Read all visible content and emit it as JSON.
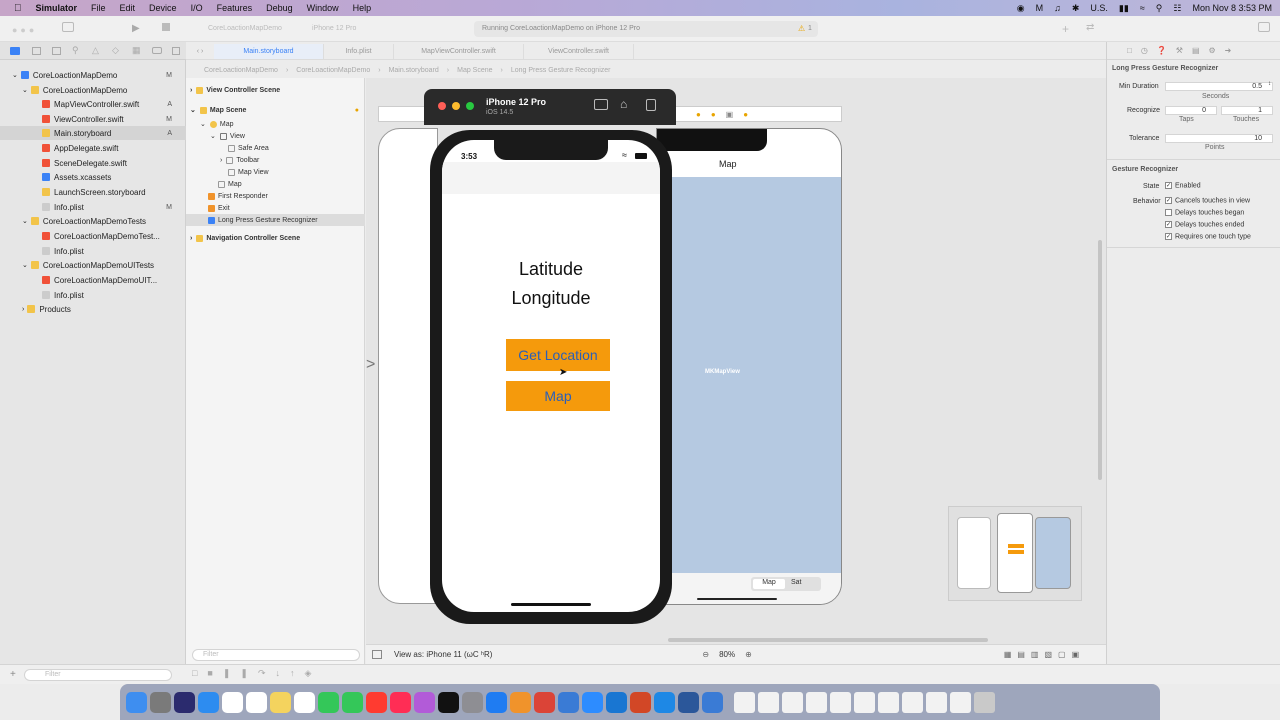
{
  "menubar": {
    "apple": "",
    "app": "Simulator",
    "items": [
      "File",
      "Edit",
      "Device",
      "I/O",
      "Features",
      "Debug",
      "Window",
      "Help"
    ],
    "status": {
      "locale": "U.S.",
      "datetime": "Mon Nov 8  3:53 PM"
    }
  },
  "toolbar": {
    "scheme": "CoreLoactionMapDemo",
    "device": "iPhone 12 Pro",
    "activity": "Running CoreLoactionMapDemo on iPhone 12 Pro",
    "warnings": "1"
  },
  "tabs": [
    "Main.storyboard",
    "Info.plist",
    "MapViewController.swift",
    "ViewController.swift"
  ],
  "jumpbar": [
    "CoreLoactionMapDemo",
    "CoreLoactionMapDemo",
    "Main.storyboard",
    "Map Scene",
    "Long Press Gesture Recognizer"
  ],
  "navigator": {
    "items": [
      {
        "label": "CoreLoactionMapDemo",
        "status": "M"
      },
      {
        "label": "CoreLoactionMapDemo",
        "status": ""
      },
      {
        "label": "MapViewController.swift",
        "status": "A"
      },
      {
        "label": "ViewController.swift",
        "status": "M"
      },
      {
        "label": "Main.storyboard",
        "status": "A"
      },
      {
        "label": "AppDelegate.swift",
        "status": ""
      },
      {
        "label": "SceneDelegate.swift",
        "status": ""
      },
      {
        "label": "Assets.xcassets",
        "status": ""
      },
      {
        "label": "LaunchScreen.storyboard",
        "status": ""
      },
      {
        "label": "Info.plist",
        "status": "M"
      },
      {
        "label": "CoreLoactionMapDemoTests",
        "status": ""
      },
      {
        "label": "CoreLoactionMapDemoTest...",
        "status": ""
      },
      {
        "label": "Info.plist",
        "status": ""
      },
      {
        "label": "CoreLoactionMapDemoUITests",
        "status": ""
      },
      {
        "label": "CoreLoactionMapDemoUIT...",
        "status": ""
      },
      {
        "label": "Info.plist",
        "status": ""
      },
      {
        "label": "Products",
        "status": ""
      }
    ],
    "filter_placeholder": "Filter"
  },
  "outline": {
    "items": [
      "View Controller Scene",
      "Map Scene",
      "Map",
      "View",
      "Safe Area",
      "Toolbar",
      "Map View",
      "Map",
      "First Responder",
      "Exit",
      "Long Press Gesture Recognizer",
      "Navigation Controller Scene"
    ],
    "filter_placeholder": "Filter"
  },
  "simulator": {
    "title": "iPhone 12 Pro",
    "subtitle": "iOS 14.5"
  },
  "phone": {
    "time": "3:53",
    "latitude": "Latitude",
    "longitude": "Longitude",
    "get_location": "Get Location",
    "map": "Map"
  },
  "storyboard": {
    "nav_title": "Map",
    "mapview_label": "MKMapView",
    "seg_map": "Map",
    "seg_sat": "Sat"
  },
  "canvas_bottom": {
    "view_as": "View as: iPhone 11 (ωC ʰR)",
    "zoom": "80%"
  },
  "inspector": {
    "section_title": "Long Press Gesture Recognizer",
    "min_duration_label": "Min Duration",
    "min_duration": "0.5",
    "seconds": "Seconds",
    "recognize_label": "Recognize",
    "taps": "0",
    "touches": "1",
    "taps_label": "Taps",
    "touches_label": "Touches",
    "tolerance_label": "Tolerance",
    "tolerance": "10",
    "points": "Points",
    "gesture_title": "Gesture Recognizer",
    "state_label": "State",
    "enabled": "Enabled",
    "behavior_label": "Behavior",
    "behaviors": [
      {
        "label": "Cancels touches in view",
        "checked": true
      },
      {
        "label": "Delays touches began",
        "checked": false
      },
      {
        "label": "Delays touches ended",
        "checked": true
      },
      {
        "label": "Requires one touch type",
        "checked": true
      }
    ]
  },
  "dock_colors": [
    "#3e8ef0",
    "#7a7a7a",
    "#2b2b6e",
    "#2d8cf0",
    "#ffffff",
    "#ffffff",
    "#f4d35e",
    "#ffffff",
    "#34c759",
    "#34c759",
    "#ff3b30",
    "#ff2d55",
    "#b25bd8",
    "#111111",
    "#8e8e93",
    "#1f7cf2",
    "#f0932b",
    "#db4437",
    "#3a7bd5",
    "#2d8cff",
    "#1976d2",
    "#d24726",
    "#1e88e5",
    "#2b579a",
    "#3a7bd5"
  ],
  "colors": {
    "orange": "#f59a0c",
    "button_text": "#2a5fb8",
    "map_blue": "#b5c9e1"
  }
}
